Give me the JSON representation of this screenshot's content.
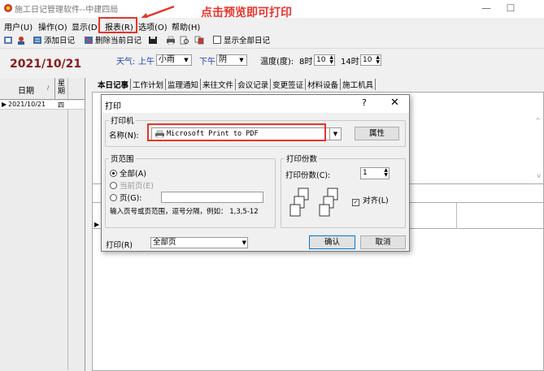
{
  "window": {
    "title": "施工日记管理软件--中建四局",
    "minimize": "—",
    "maximize": "☐",
    "close": "✕"
  },
  "annotation": {
    "text": "点击预览即可打印",
    "color": "#e8332a"
  },
  "menu": [
    {
      "label": "用户(U)"
    },
    {
      "label": "操作(O)"
    },
    {
      "label": "显示(D)"
    },
    {
      "label": "报表(R)"
    },
    {
      "label": "选项(O)"
    },
    {
      "label": "帮助(H)"
    }
  ],
  "toolbar": {
    "add_diary": "添加日记",
    "delete_diary": "删除当前日记",
    "show_all": "显示全部日记"
  },
  "left_panel": {
    "current_date": "2021/10/21",
    "col_date": "日期",
    "col_week": "星期",
    "sort_glyph": "/",
    "row": {
      "marker": "▶",
      "date": "2021/10/21",
      "week": "四"
    }
  },
  "weather": {
    "label": "天气:",
    "am_label": "上午",
    "am_value": "小雨",
    "pm_label": "下午",
    "pm_value": "阴",
    "temp_label": "温度(度):",
    "t8_label": "8时",
    "t8_value": "10",
    "t14_label": "14时",
    "t14_value": "10"
  },
  "tabs": [
    {
      "label": "本日记事"
    },
    {
      "label": "工作计划"
    },
    {
      "label": "监理通知"
    },
    {
      "label": "来往文件"
    },
    {
      "label": "会议记录"
    },
    {
      "label": "变更签证"
    },
    {
      "label": "材料设备"
    },
    {
      "label": "施工机具"
    }
  ],
  "main": {
    "row_marker": "▶",
    "scroll_up": "^",
    "scroll_down": "v"
  },
  "dialog": {
    "title": "打印",
    "help": "?",
    "close": "✕",
    "printer_group": "打印机",
    "name_label": "名称(N):",
    "printer_name": "Microsoft Print to PDF",
    "properties_button": "属性",
    "range_group": "页范围",
    "range_all": "全部(A)",
    "range_current": "当前页(E)",
    "range_pages": "页(G):",
    "range_hint": "输入页号或页范围，逗号分隔，例如： 1,3,5-12",
    "copies_group": "打印份数",
    "copies_label": "打印份数(C):",
    "copies_value": "1",
    "collate_label": "对齐(L)",
    "collate_check": "✓",
    "print_what_label": "打印(R)",
    "print_what_value": "全部页",
    "ok_button": "确认",
    "cancel_button": "取消",
    "dropdown_glyph": "▼"
  }
}
